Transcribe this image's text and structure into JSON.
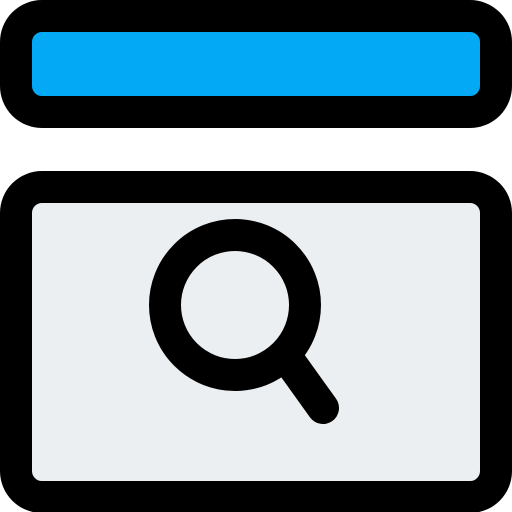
{
  "icon": {
    "name": "browser-search-icon",
    "colors": {
      "outline": "#000000",
      "header_bar": "#03A9F4",
      "content_panel": "#ECEFF1",
      "background": "#FFFFFF"
    }
  }
}
